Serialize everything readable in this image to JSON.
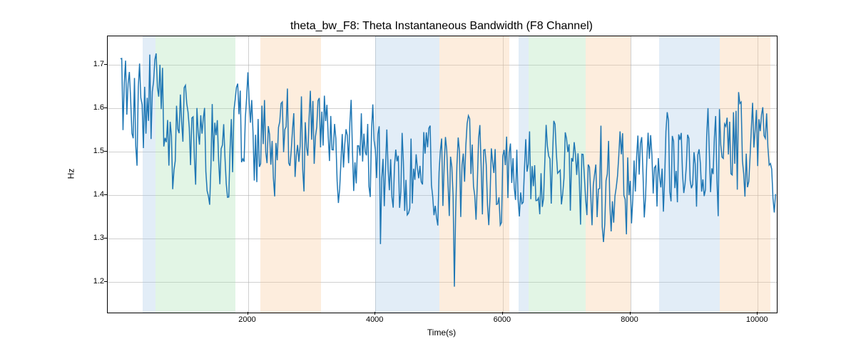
{
  "chart_data": {
    "type": "line",
    "title": "theta_bw_F8: Theta Instantaneous Bandwidth (F8 Channel)",
    "xlabel": "Time(s)",
    "ylabel": "Hz",
    "xlim": [
      -200,
      10300
    ],
    "ylim": [
      1.13,
      1.765
    ],
    "xticks": [
      2000,
      4000,
      6000,
      8000,
      10000
    ],
    "yticks": [
      1.2,
      1.3,
      1.4,
      1.5,
      1.6,
      1.7
    ],
    "shaded_regions": [
      {
        "start": 350,
        "end": 550,
        "color": "blue"
      },
      {
        "start": 550,
        "end": 1800,
        "color": "green"
      },
      {
        "start": 2200,
        "end": 3150,
        "color": "orange"
      },
      {
        "start": 4000,
        "end": 4200,
        "color": "blue"
      },
      {
        "start": 4200,
        "end": 5000,
        "color": "blue"
      },
      {
        "start": 5000,
        "end": 6100,
        "color": "orange"
      },
      {
        "start": 6250,
        "end": 6400,
        "color": "blue"
      },
      {
        "start": 6400,
        "end": 7300,
        "color": "green"
      },
      {
        "start": 7300,
        "end": 8000,
        "color": "orange"
      },
      {
        "start": 8450,
        "end": 9400,
        "color": "blue"
      },
      {
        "start": 9400,
        "end": 10200,
        "color": "orange"
      }
    ],
    "series": [
      {
        "name": "theta_bw_F8",
        "x_start": 0,
        "x_step": 20,
        "seed": 12345,
        "n": 515,
        "base": 1.46,
        "trend_start_bonus": 0.13,
        "trend_decay": 100,
        "noise_amp": 0.17,
        "drift_amp": 0.03
      }
    ]
  }
}
